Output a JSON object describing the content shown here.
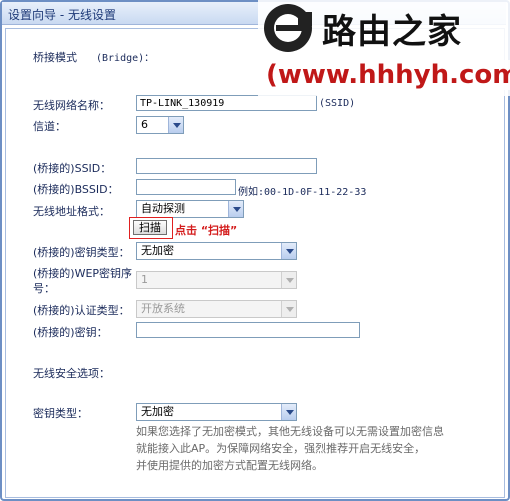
{
  "window": {
    "title": "设置向导 - 无线设置"
  },
  "section": {
    "mode_label": "桥接模式",
    "mode_value": "(Bridge)："
  },
  "fields": {
    "ssid_label": "无线网络名称：",
    "ssid_value": "TP-LINK_130919",
    "ssid_hint": "(SSID)",
    "channel_label": "信道：",
    "channel_value": "6",
    "bridge_ssid_label": "(桥接的)SSID：",
    "bridge_ssid_value": "",
    "bridge_bssid_label": "(桥接的)BSSID：",
    "bridge_bssid_value": "",
    "bssid_example": "例如:00-1D-0F-11-22-33",
    "addr_format_label": "无线地址格式：",
    "addr_format_value": "自动探测",
    "scan_button": "扫描",
    "scan_hint": "点击 “扫描”",
    "key_type_label": "(桥接的)密钥类型：",
    "key_type_value": "无加密",
    "wep_index_label_1": "(桥接的)WEP密钥序",
    "wep_index_label_2": "号：",
    "wep_index_value": "1",
    "auth_type_label": "(桥接的)认证类型：",
    "auth_type_value": "开放系统",
    "key_label": "(桥接的)密钥：",
    "key_value": ""
  },
  "security": {
    "heading": "无线安全选项：",
    "key_type_label": "密钥类型：",
    "key_type_value": "无加密",
    "note_line1": "如果您选择了无加密模式，其他无线设备可以无需设置加密信息",
    "note_line2": "就能接入此AP。为保障网络安全，强烈推荐开启无线安全，",
    "note_line3": "并使用提供的加密方式配置无线网络。"
  },
  "watermark": {
    "brand": "路由之家",
    "url": "(www.hhhyh.com)"
  },
  "colors": {
    "accent": "#6d8fc4",
    "hint_red": "#d41c1c",
    "text": "#1a2a5a"
  }
}
